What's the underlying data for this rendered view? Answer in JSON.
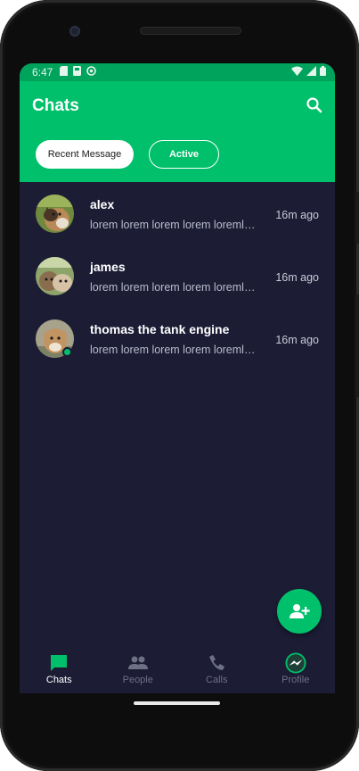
{
  "status_bar": {
    "time": "6:47"
  },
  "appbar": {
    "title": "Chats"
  },
  "filters": [
    {
      "label": "Recent Message",
      "selected": true
    },
    {
      "label": "Active",
      "selected": false
    }
  ],
  "chats": [
    {
      "name": "alex",
      "preview": "lorem lorem lorem lorem loremlorem",
      "time": "16m ago",
      "online": false
    },
    {
      "name": "james",
      "preview": "lorem lorem lorem lorem loremlorem",
      "time": "16m ago",
      "online": false
    },
    {
      "name": "thomas the tank engine",
      "preview": "lorem lorem lorem lorem loremlorem",
      "time": "16m ago",
      "online": true
    }
  ],
  "bottom_nav": [
    {
      "label": "Chats",
      "icon": "chat-bubble-icon",
      "selected": true
    },
    {
      "label": "People",
      "icon": "people-icon",
      "selected": false
    },
    {
      "label": "Calls",
      "icon": "phone-icon",
      "selected": false
    },
    {
      "label": "Profile",
      "icon": "messenger-icon",
      "selected": false
    }
  ],
  "fab": {
    "icon": "add-person-icon"
  },
  "colors": {
    "accent": "#00c06b",
    "background": "#1c1c35",
    "status_bar": "#00a35c",
    "muted": "#6e7086"
  }
}
